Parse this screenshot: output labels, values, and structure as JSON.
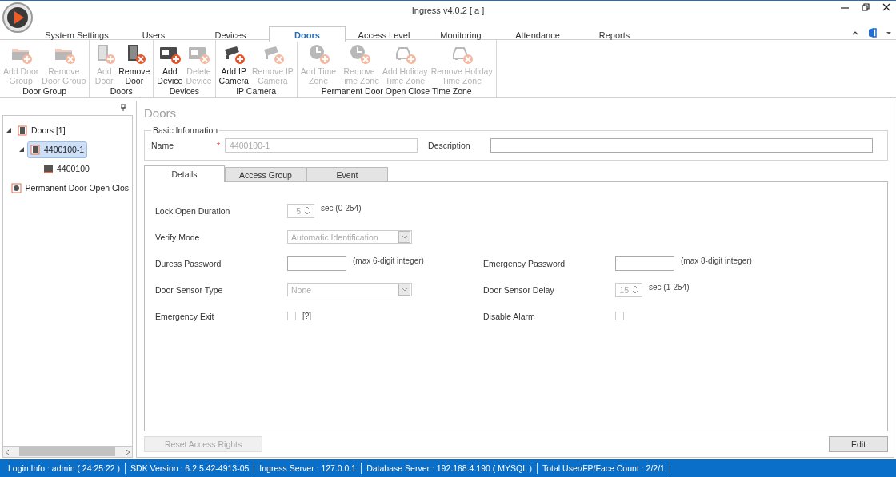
{
  "window": {
    "title": "Ingress v4.0.2 [ a ]"
  },
  "tabs": [
    {
      "label": "System Settings",
      "selected": false
    },
    {
      "label": "Users",
      "selected": false
    },
    {
      "label": "Devices",
      "selected": false
    },
    {
      "label": "Doors",
      "selected": true
    },
    {
      "label": "Access Level",
      "selected": false
    },
    {
      "label": "Monitoring",
      "selected": false
    },
    {
      "label": "Attendance",
      "selected": false
    },
    {
      "label": "Reports",
      "selected": false
    }
  ],
  "ribbon": [
    {
      "label": "Door Group",
      "buttons": [
        {
          "lines": [
            "Add Door",
            "Group"
          ],
          "kind": "folder",
          "add": true,
          "disabled": true
        },
        {
          "lines": [
            "Remove",
            "Door Group"
          ],
          "kind": "folder",
          "add": false,
          "disabled": true
        }
      ]
    },
    {
      "label": "Doors",
      "buttons": [
        {
          "lines": [
            "Add",
            "Door"
          ],
          "kind": "door",
          "add": true,
          "disabled": true
        },
        {
          "lines": [
            "Remove",
            "Door"
          ],
          "kind": "door",
          "add": false,
          "disabled": false
        }
      ]
    },
    {
      "label": "Devices",
      "buttons": [
        {
          "lines": [
            "Add",
            "Device"
          ],
          "kind": "device",
          "add": true,
          "disabled": false
        },
        {
          "lines": [
            "Delete",
            "Device"
          ],
          "kind": "device",
          "add": false,
          "disabled": true
        }
      ]
    },
    {
      "label": "IP Camera",
      "buttons": [
        {
          "lines": [
            "Add IP",
            "Camera"
          ],
          "kind": "camera",
          "add": true,
          "disabled": false
        },
        {
          "lines": [
            "Remove IP",
            "Camera"
          ],
          "kind": "camera",
          "add": false,
          "disabled": true
        }
      ]
    },
    {
      "label": "Permanent Door Open Close Time Zone",
      "buttons": [
        {
          "lines": [
            "Add Time",
            "Zone"
          ],
          "kind": "clock",
          "add": true,
          "disabled": true
        },
        {
          "lines": [
            "Remove",
            "Time Zone"
          ],
          "kind": "clock",
          "add": false,
          "disabled": true
        },
        {
          "lines": [
            "Add Holiday",
            "Time Zone"
          ],
          "kind": "car",
          "add": true,
          "disabled": true
        },
        {
          "lines": [
            "Remove Holiday",
            "Time Zone"
          ],
          "kind": "car",
          "add": false,
          "disabled": true
        }
      ]
    }
  ],
  "tree": [
    {
      "label": "Doors [1]",
      "kind": "group",
      "expanded": true,
      "selected": false,
      "children": [
        {
          "label": "4400100-1",
          "kind": "door",
          "expanded": true,
          "selected": true,
          "children": [
            {
              "label": "4400100",
              "kind": "reader",
              "selected": false
            }
          ]
        }
      ]
    },
    {
      "label": "Permanent Door Open Clos",
      "kind": "timezone",
      "selected": false
    }
  ],
  "panel": {
    "title": "Doors",
    "basic_info": {
      "legend": "Basic Information",
      "name_label": "Name",
      "required_mark": "*",
      "name_value": "4400100-1",
      "name_disabled": true,
      "description_label": "Description"
    },
    "tabs": [
      {
        "label": "Details",
        "selected": true
      },
      {
        "label": "Access Group",
        "selected": false
      },
      {
        "label": "Event",
        "selected": false
      }
    ],
    "rows": [
      [
        {
          "label": "Lock Open Duration",
          "kind": "spinner",
          "value": "5",
          "hint": "sec (0-254)",
          "disabled": true
        }
      ],
      [
        {
          "label": "Verify Mode",
          "kind": "select",
          "value": "Automatic Identification",
          "disabled": true
        }
      ],
      [
        {
          "label": "Duress Password",
          "kind": "text",
          "hint": "(max 6-digit integer)",
          "disabled": false
        },
        {
          "label": "Emergency Password",
          "kind": "text",
          "hint": "(max 8-digit integer)",
          "disabled": false
        }
      ],
      [
        {
          "label": "Door Sensor Type",
          "kind": "select",
          "value": "None",
          "disabled": true
        },
        {
          "label": "Door Sensor Delay",
          "kind": "spinner",
          "value": "15",
          "hint": "sec (1-254)",
          "disabled": true
        }
      ],
      [
        {
          "label": "Emergency Exit",
          "kind": "checkbox",
          "checked": false,
          "hint": "[?]",
          "disabled": true
        },
        {
          "label": "Disable Alarm",
          "kind": "checkbox",
          "checked": false,
          "disabled": true
        }
      ]
    ],
    "buttons": [
      {
        "label": "Reset Access Rights",
        "disabled": true
      },
      {
        "label": "Edit",
        "disabled": false
      }
    ]
  },
  "status_bar": [
    "Login Info : admin ( 24:25:22 )",
    "SDK Version : 6.2.5.42-4913-05",
    "Ingress Server : 127.0.0.1",
    "Database Server : 192.168.4.190 ( MYSQL )",
    "Total User/FP/Face Count : 2/2/1"
  ]
}
